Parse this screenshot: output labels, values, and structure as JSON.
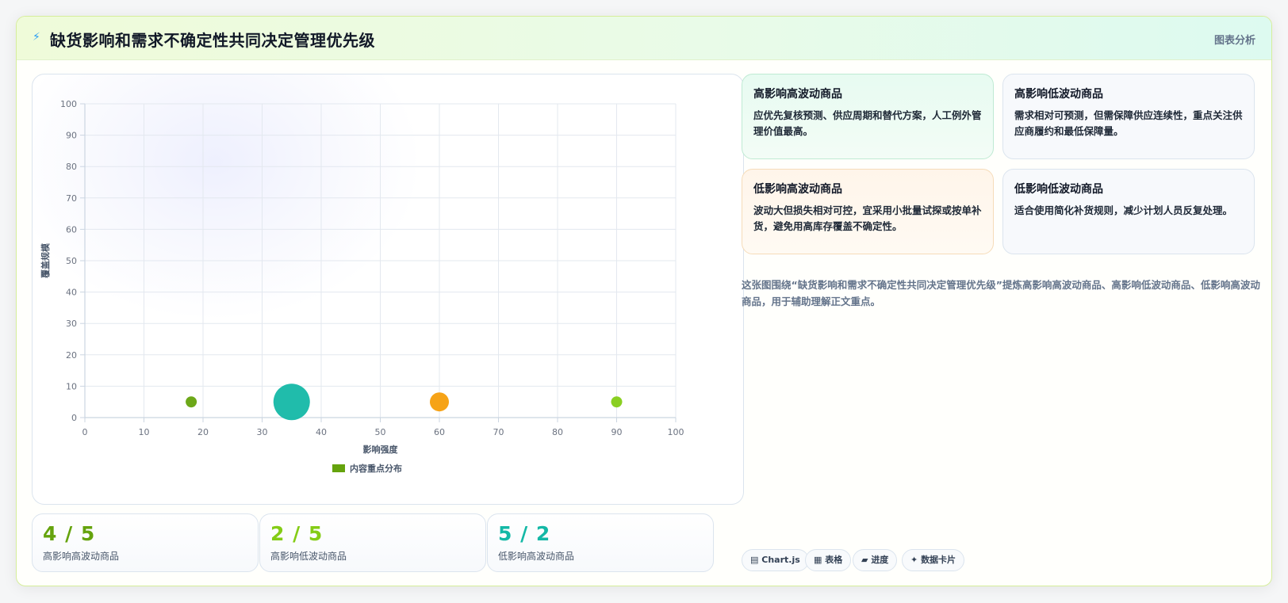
{
  "header": {
    "icon": "lightning-icon",
    "title": "缺货影响和需求不确定性共同决定管理优先级",
    "tag": "图表分析"
  },
  "chart_data": {
    "type": "bubble",
    "title": "",
    "xlabel": "影响强度",
    "ylabel": "覆盖规模",
    "xlim": [
      0,
      100
    ],
    "ylim": [
      0,
      100
    ],
    "xticks": [
      0,
      10,
      20,
      30,
      40,
      50,
      60,
      70,
      80,
      90,
      100
    ],
    "yticks": [
      0,
      10,
      20,
      30,
      40,
      50,
      60,
      70,
      80,
      90,
      100
    ],
    "grid": true,
    "legend_position": "bottom",
    "series": [
      {
        "name": "内容重点分布",
        "color": "#65a30d",
        "points": [
          {
            "x": 18,
            "y": 5,
            "r": 7,
            "color": "#65a30d"
          },
          {
            "x": 35,
            "y": 5,
            "r": 23,
            "color": "#14b8a6"
          },
          {
            "x": 60,
            "y": 5,
            "r": 12,
            "color": "#f59e0b"
          },
          {
            "x": 90,
            "y": 5,
            "r": 7,
            "color": "#84cc16"
          }
        ]
      }
    ]
  },
  "stats": [
    {
      "value": "4 / 5",
      "label": "高影响高波动商品",
      "color": "#65a30d"
    },
    {
      "value": "2 / 5",
      "label": "高影响低波动商品",
      "color": "#84cc16"
    },
    {
      "value": "5 / 2",
      "label": "低影响高波动商品",
      "color": "#14b8a6"
    }
  ],
  "quadrants": [
    {
      "title": "高影响高波动商品",
      "desc": "应优先复核预测、供应周期和替代方案，人工例外管理价值最高。"
    },
    {
      "title": "高影响低波动商品",
      "desc": "需求相对可预测，但需保障供应连续性，重点关注供应商履约和最低保障量。"
    },
    {
      "title": "低影响高波动商品",
      "desc": "波动大但损失相对可控，宜采用小批量试探或按单补货，避免用高库存覆盖不确定性。"
    },
    {
      "title": "低影响低波动商品",
      "desc": "适合使用简化补货规则，减少计划人员反复处理。"
    }
  ],
  "summary": "这张图围绕“缺货影响和需求不确定性共同决定管理优先级”提炼高影响高波动商品、高影响低波动商品、低影响高波动商品，用于辅助理解正文重点。",
  "chips": [
    {
      "icon": "chart-icon",
      "label": "Chart.js"
    },
    {
      "icon": "table-icon",
      "label": "表格"
    },
    {
      "icon": "progress-icon",
      "label": "进度"
    },
    {
      "icon": "sparkle-icon",
      "label": "数据卡片"
    }
  ]
}
